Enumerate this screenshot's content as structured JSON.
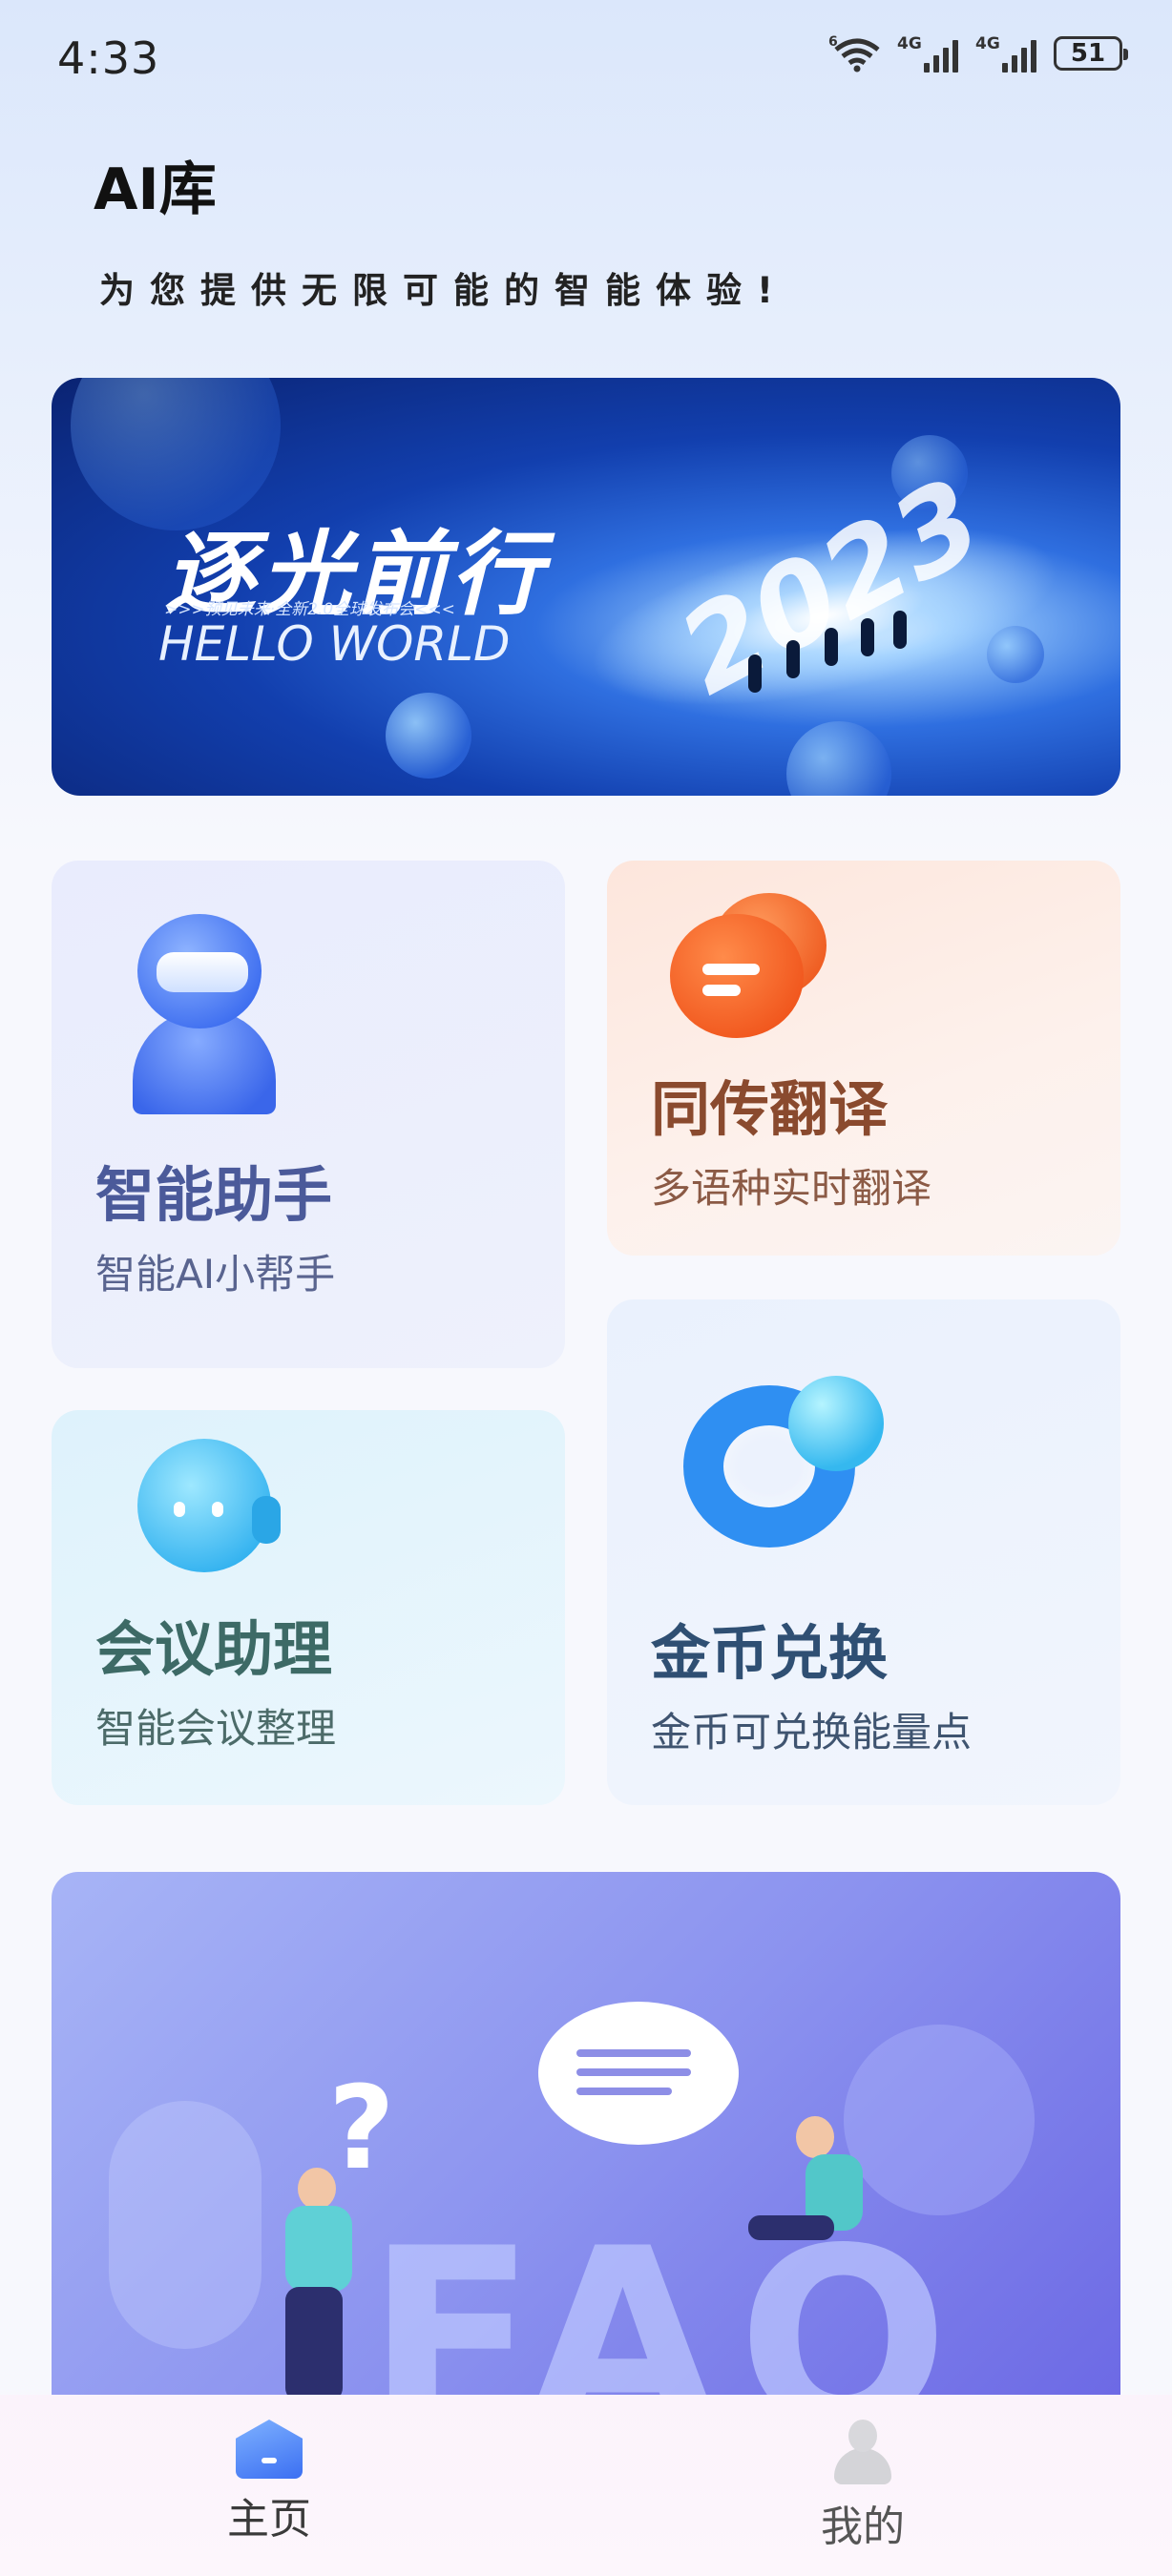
{
  "status_bar": {
    "time": "4:33",
    "wifi_label": "6",
    "signal1_label": "4G",
    "signal2_label": "4G",
    "battery": "51"
  },
  "header": {
    "title": "AI库",
    "subtitle": "为您提供无限可能的智能体验!"
  },
  "banner": {
    "title": "逐光前行",
    "tagline": ">>>预见未来·全新2.0全球发布会<<<",
    "hello": "HELLO WORLD",
    "year": "2023"
  },
  "features": [
    {
      "title": "智能助手",
      "desc": "智能AI小帮手",
      "icon": "robot-assistant-icon",
      "title_color": "#4b5a9a",
      "desc_color": "#59648f"
    },
    {
      "title": "同传翻译",
      "desc": "多语种实时翻译",
      "icon": "chat-bubbles-icon",
      "title_color": "#8a4a2e",
      "desc_color": "#8b5a45"
    },
    {
      "title": "会议助理",
      "desc": "智能会议整理",
      "icon": "headset-bot-icon",
      "title_color": "#3d6a66",
      "desc_color": "#4c6b69"
    },
    {
      "title": "金币兑换",
      "desc": "金币可兑换能量点",
      "icon": "coin-ring-icon",
      "title_color": "#2f4f73",
      "desc_color": "#3f5470"
    }
  ],
  "faq_banner": {
    "text": "FAQ"
  },
  "tabbar": {
    "home_label": "主页",
    "me_label": "我的",
    "active_color": "#3a3a3a",
    "inactive_color": "#555555"
  }
}
